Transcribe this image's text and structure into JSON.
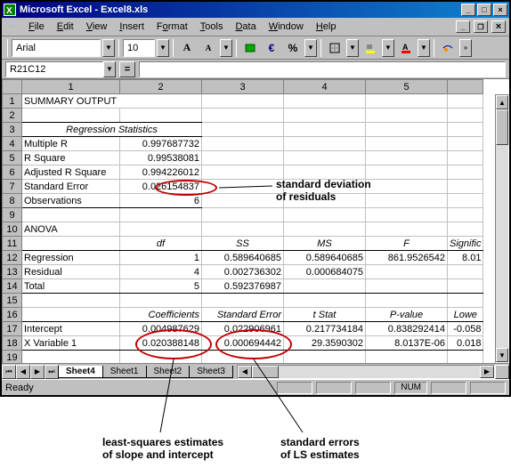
{
  "window": {
    "title": "Microsoft Excel - Excel8.xls"
  },
  "menu": {
    "file": "File",
    "edit": "Edit",
    "view": "View",
    "insert": "Insert",
    "format": "Format",
    "tools": "Tools",
    "data": "Data",
    "window": "Window",
    "help": "Help"
  },
  "toolbar": {
    "font": "Arial",
    "size": "10"
  },
  "namebox": "R21C12",
  "columns": [
    "1",
    "2",
    "3",
    "4",
    "5"
  ],
  "rows": [
    "1",
    "2",
    "3",
    "4",
    "5",
    "6",
    "7",
    "8",
    "9",
    "10",
    "11",
    "12",
    "13",
    "14",
    "15",
    "16",
    "17",
    "18",
    "19"
  ],
  "cells": {
    "r1c1": "SUMMARY OUTPUT",
    "r3c1": "Regression Statistics",
    "r4c1": "Multiple R",
    "r4c2": "0.997687732",
    "r5c1": "R Square",
    "r5c2": "0.99538081",
    "r6c1": "Adjusted R Square",
    "r6c2": "0.994226012",
    "r7c1": "Standard Error",
    "r7c2": "0.026154837",
    "r8c1": "Observations",
    "r8c2": "6",
    "r10c1": "ANOVA",
    "r11c2": "df",
    "r11c3": "SS",
    "r11c4": "MS",
    "r11c5": "F",
    "r11c6": "Signific",
    "r12c1": "Regression",
    "r12c2": "1",
    "r12c3": "0.589640685",
    "r12c4": "0.589640685",
    "r12c5": "861.9526542",
    "r12c6": "8.01",
    "r13c1": "Residual",
    "r13c2": "4",
    "r13c3": "0.002736302",
    "r13c4": "0.000684075",
    "r14c1": "Total",
    "r14c2": "5",
    "r14c3": "0.592376987",
    "r16c2": "Coefficients",
    "r16c3": "Standard Error",
    "r16c4": "t Stat",
    "r16c5": "P-value",
    "r16c6": "Lowe",
    "r17c1": "Intercept",
    "r17c2": "0.004987629",
    "r17c3": "0.022906961",
    "r17c4": "0.217734184",
    "r17c5": "0.838292414",
    "r17c6": "-0.058",
    "r18c1": "X Variable 1",
    "r18c2": "0.020388148",
    "r18c3": "0.000694442",
    "r18c4": "29.3590302",
    "r18c5": "8.0137E-06",
    "r18c6": "0.018"
  },
  "tabs": {
    "t1": "Sheet4",
    "t2": "Sheet1",
    "t3": "Sheet2",
    "t4": "Sheet3"
  },
  "status": {
    "ready": "Ready",
    "num": "NUM"
  },
  "annotations": {
    "a1": "standard deviation\nof residuals",
    "a2": "least-squares estimates\nof slope and intercept",
    "a3": "standard errors\nof LS estimates"
  }
}
